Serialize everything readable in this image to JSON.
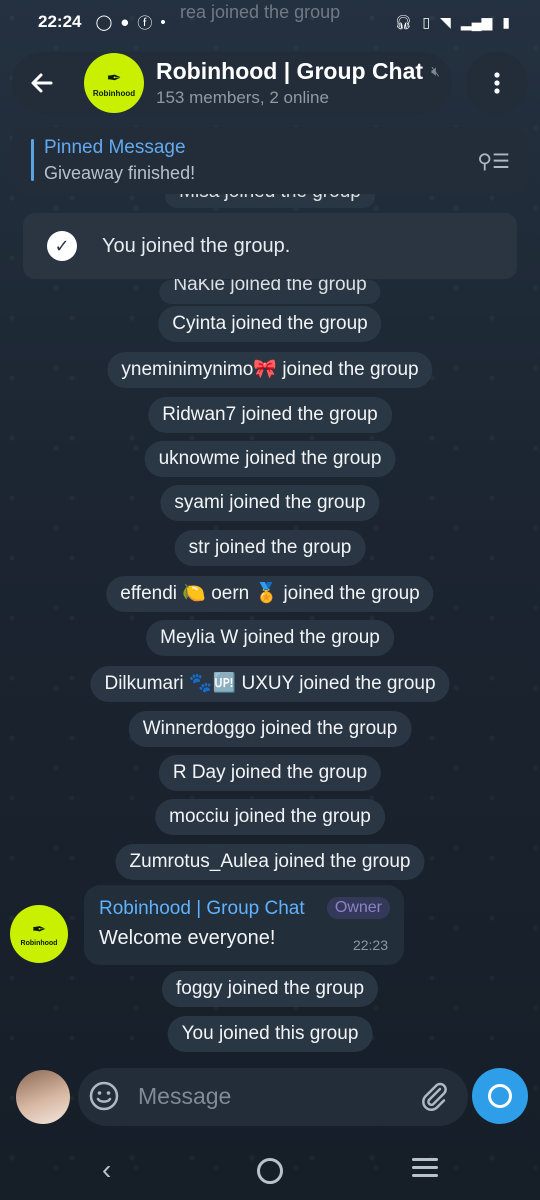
{
  "status": {
    "time": "22:24",
    "ghost_text": "rea joined the group"
  },
  "header": {
    "title": "Robinhood | Group Chat",
    "subtitle": "153 members, 2 online",
    "logo_text": "Robinhood"
  },
  "pinned": {
    "title": "Pinned Message",
    "text": "Giveaway finished!"
  },
  "toast": {
    "text": "You joined the group."
  },
  "service_messages": [
    "Misa joined the group",
    "NaKie joined the group",
    "Cyinta joined the group",
    "yneminimynimo🎀 joined the group",
    "Ridwan7 joined the group",
    "uknowme joined the group",
    "syami joined the group",
    "str joined the group",
    "effendi 🍋 oern 🏅 joined the group",
    "Meylia W joined the group",
    "Dilkumari 🐾🆙 UXUY joined the group",
    "Winnerdoggo joined the group",
    "R Day joined the group",
    "mocciu joined the group",
    "Zumrotus_Aulea joined the group",
    "foggy joined the group",
    "You joined this group"
  ],
  "message": {
    "sender": "Robinhood | Group Chat",
    "badge": "Owner",
    "text": "Welcome everyone!",
    "time": "22:23"
  },
  "input": {
    "placeholder": "Message"
  },
  "colors": {
    "accent": "#2f9ee8",
    "brand": "#c8f000",
    "link": "#62aaf0"
  }
}
